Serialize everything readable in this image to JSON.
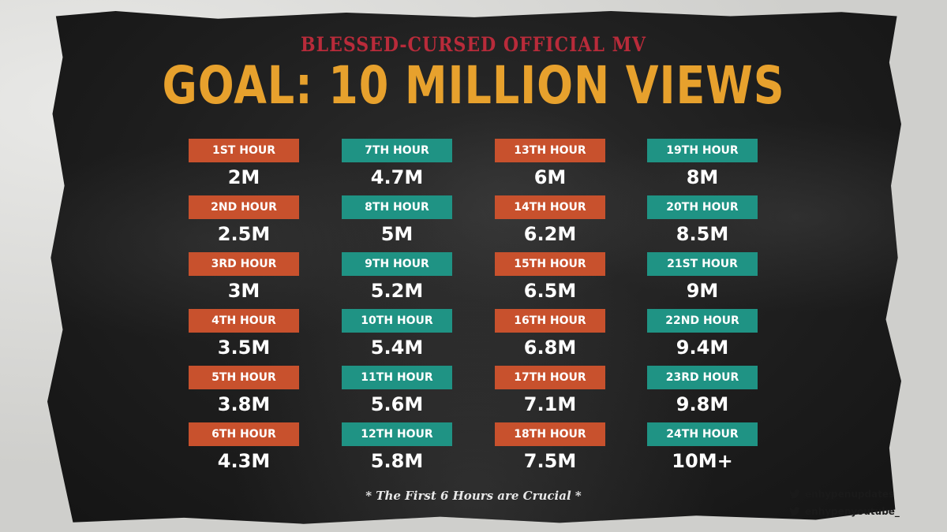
{
  "header": {
    "subtitle": "BLESSED-CURSED OFFICIAL MV",
    "title": "GOAL: 10 MILLION VIEWS"
  },
  "colors": {
    "orange_badge": "#c8512d",
    "teal_badge": "#1f9384",
    "title": "#e7a12d",
    "subtitle": "#b82b3a"
  },
  "columns": [
    {
      "color": "orange",
      "items": [
        {
          "label": "1ST HOUR",
          "value": "2M"
        },
        {
          "label": "2ND HOUR",
          "value": "2.5M"
        },
        {
          "label": "3RD HOUR",
          "value": "3M"
        },
        {
          "label": "4TH HOUR",
          "value": "3.5M"
        },
        {
          "label": "5TH HOUR",
          "value": "3.8M"
        },
        {
          "label": "6TH HOUR",
          "value": "4.3M"
        }
      ]
    },
    {
      "color": "teal",
      "items": [
        {
          "label": "7TH HOUR",
          "value": "4.7M"
        },
        {
          "label": "8TH HOUR",
          "value": "5M"
        },
        {
          "label": "9TH HOUR",
          "value": "5.2M"
        },
        {
          "label": "10TH HOUR",
          "value": "5.4M"
        },
        {
          "label": "11TH HOUR",
          "value": "5.6M"
        },
        {
          "label": "12TH HOUR",
          "value": "5.8M"
        }
      ]
    },
    {
      "color": "orange",
      "items": [
        {
          "label": "13TH HOUR",
          "value": "6M"
        },
        {
          "label": "14TH HOUR",
          "value": "6.2M"
        },
        {
          "label": "15TH HOUR",
          "value": "6.5M"
        },
        {
          "label": "16TH HOUR",
          "value": "6.8M"
        },
        {
          "label": "17TH HOUR",
          "value": "7.1M"
        },
        {
          "label": "18TH HOUR",
          "value": "7.5M"
        }
      ]
    },
    {
      "color": "teal",
      "items": [
        {
          "label": "19TH HOUR",
          "value": "8M"
        },
        {
          "label": "20TH HOUR",
          "value": "8.5M"
        },
        {
          "label": "21ST HOUR",
          "value": "9M"
        },
        {
          "label": "22ND HOUR",
          "value": "9.4M"
        },
        {
          "label": "23RD HOUR",
          "value": "9.8M"
        },
        {
          "label": "24TH HOUR",
          "value": "10M+"
        }
      ]
    }
  ],
  "note": "* The First 6 Hours are Crucial *",
  "social": {
    "icon": "twitter-bird-icon",
    "handles": [
      "enhypenupdates",
      "enhypenyoutube_"
    ]
  }
}
